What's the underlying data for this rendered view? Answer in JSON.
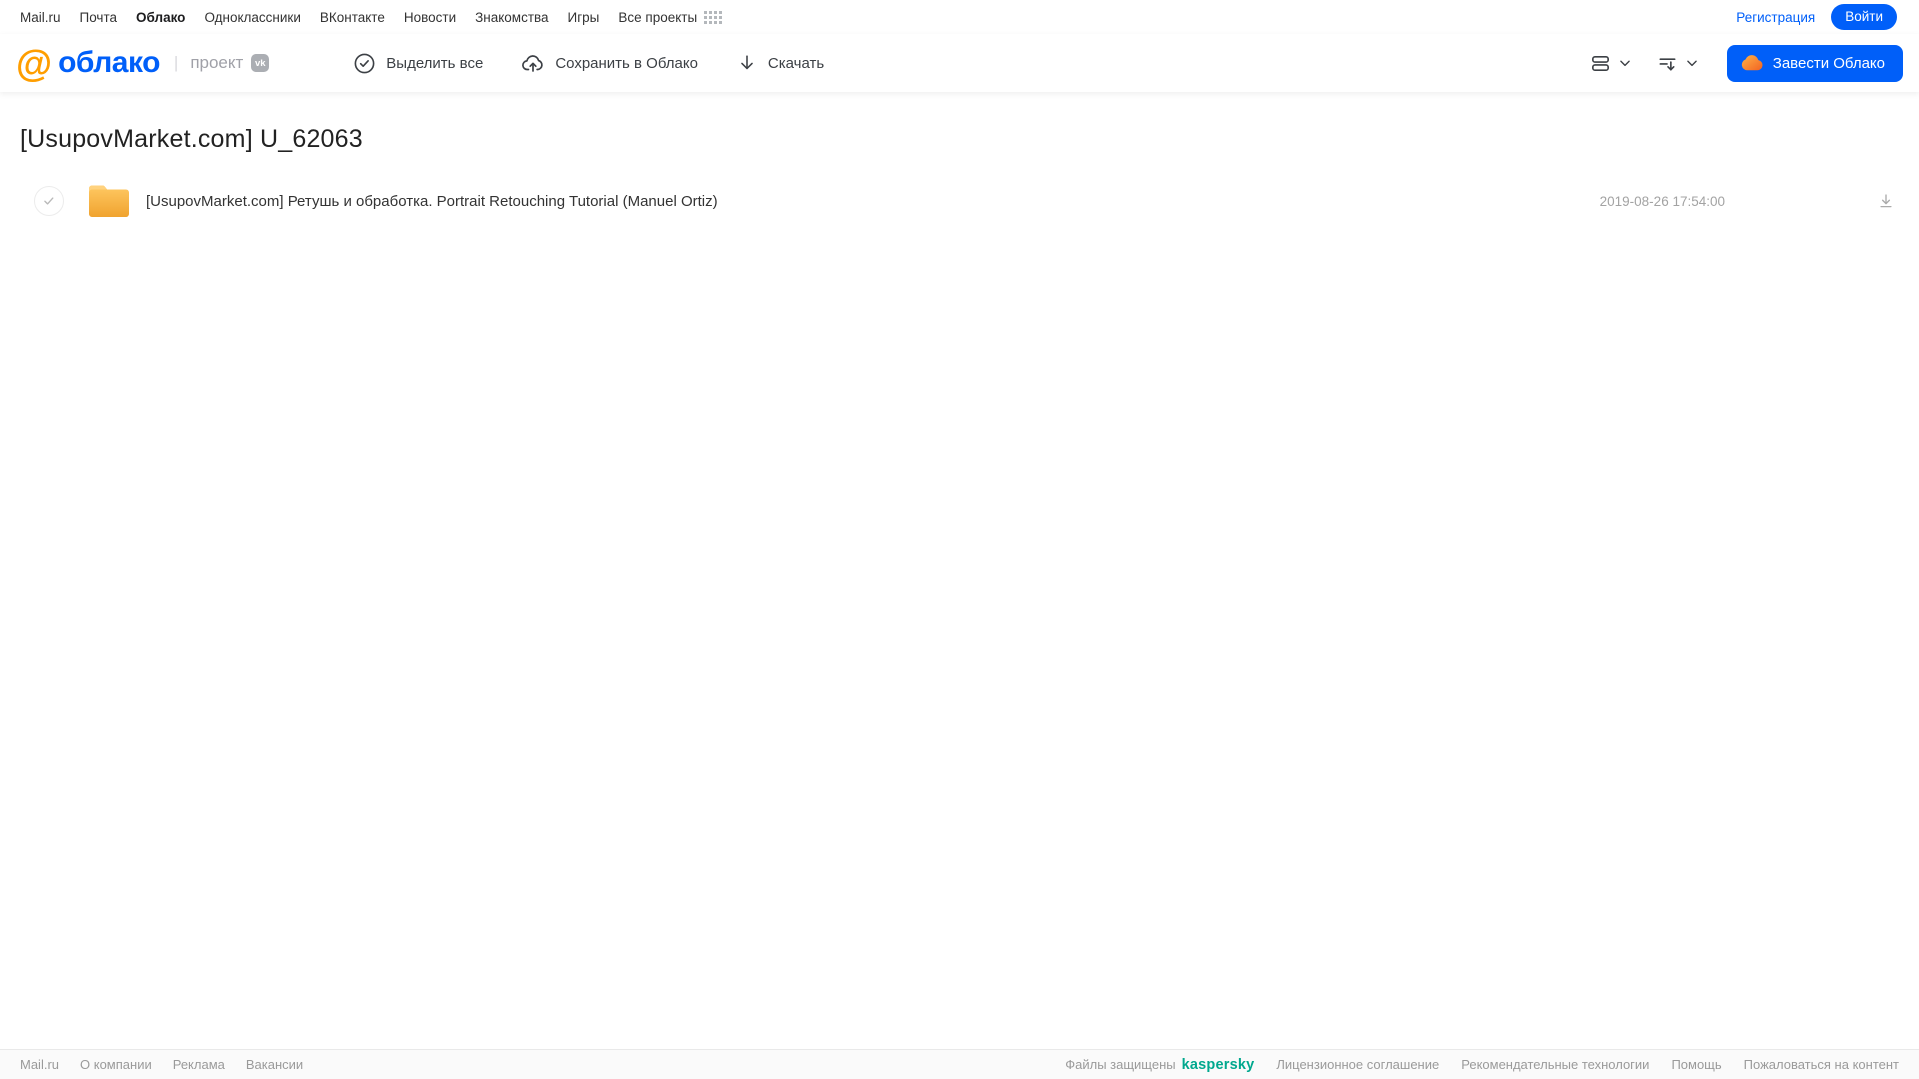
{
  "topnav": {
    "links": [
      {
        "label": "Mail.ru"
      },
      {
        "label": "Почта"
      },
      {
        "label": "Облако",
        "active": true
      },
      {
        "label": "Одноклассники"
      },
      {
        "label": "ВКонтакте"
      },
      {
        "label": "Новости"
      },
      {
        "label": "Знакомства"
      },
      {
        "label": "Игры"
      },
      {
        "label": "Все проекты"
      }
    ],
    "registration": "Регистрация",
    "login": "Войти"
  },
  "header": {
    "logo": {
      "at_symbol": "@",
      "name": "облако",
      "divider": "|",
      "project": "проект",
      "vk_badge": "vk"
    },
    "toolbar": {
      "select_all": "Выделить все",
      "save_to_cloud": "Сохранить в Облако",
      "download": "Скачать"
    },
    "get_cloud_button": "Завести Облако"
  },
  "page": {
    "title": "[UsupovMarket.com] U_62063"
  },
  "files": [
    {
      "type": "folder",
      "name": "[UsupovMarket.com] Ретушь и обработка. Portrait Retouching Tutorial (Manuel Ortiz)",
      "modified": "2019-08-26 17:54:00"
    }
  ],
  "footer": {
    "left_links": [
      {
        "label": "Mail.ru"
      },
      {
        "label": "О компании"
      },
      {
        "label": "Реклама"
      },
      {
        "label": "Вакансии"
      }
    ],
    "protected_text": "Файлы защищены",
    "kaspersky": "kaspersky",
    "right_links": [
      {
        "label": "Лицензионное соглашение"
      },
      {
        "label": "Рекомендательные технологии"
      },
      {
        "label": "Помощь"
      },
      {
        "label": "Пожаловаться на контент"
      }
    ]
  },
  "colors": {
    "accent_blue": "#005ff9",
    "logo_orange": "#ff9e00",
    "folder_yellow": "#f5a933",
    "kaspersky_teal": "#00a88e",
    "muted_gray": "#9a9a9a"
  }
}
